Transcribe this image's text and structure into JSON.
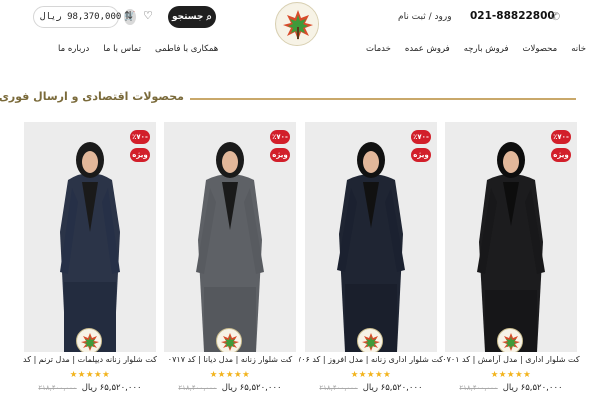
{
  "header": {
    "cart_total": "98,370,000 ریال",
    "search_label": "جستجو",
    "login_label": "ورود / ثبت نام",
    "phone": "021-88822800"
  },
  "nav": {
    "right_items": [
      "خانه",
      "محصولات",
      "فروش بارچه",
      "فروش عمده",
      "خدمات"
    ],
    "left_items": [
      "همکاری با فاطمی",
      "تماس با ما",
      "درباره ما"
    ]
  },
  "section": {
    "title": "محصولات اقتصادی و ارسال فوری"
  },
  "products": [
    {
      "title": "کت شلوار زنانه دیپلمات | مدل ترنم | کد",
      "discount": "٪۷۰-",
      "special": "ویژه",
      "stars": "★★★★★",
      "price": "۶۵,۵۲۰,۰۰۰ ریال",
      "old_price": "۲۱۸,۴۰۰,۰۰۰"
    },
    {
      "title": "کت شلوار زنانه | مدل دیانا | کد ۰۷۱۷",
      "discount": "٪۷۰-",
      "special": "ویژه",
      "stars": "★★★★★",
      "price": "۶۵,۵۲۰,۰۰۰ ریال",
      "old_price": "۲۱۸,۴۰۰,۰۰۰"
    },
    {
      "title": "کت شلوار اداری زنانه | مدل افروز | کد ۷۰۶",
      "discount": "٪۷۰-",
      "special": "ویژه",
      "stars": "★★★★★",
      "price": "۶۵,۵۲۰,۰۰۰ ریال",
      "old_price": "۲۱۸,۴۰۰,۰۰۰"
    },
    {
      "title": "کت شلوار اداری | مدل آرامش | کد ۰۷۰۱",
      "discount": "٪۷۰-",
      "special": "ویژه",
      "stars": "★★★★★",
      "price": "۶۵,۵۲۰,۰۰۰ ریال",
      "old_price": "۲۱۸,۴۰۰,۰۰۰"
    }
  ],
  "colors": {
    "accent_gold": "#c9a86a",
    "badge_red": "#d21f2a",
    "star_yellow": "#f2b31c",
    "search_black": "#1f1f1f"
  },
  "icons": {
    "cart": "cart-icon",
    "wishlist": "heart-icon",
    "compare": "compare-icon",
    "search": "search-icon",
    "phone": "phone-icon"
  }
}
